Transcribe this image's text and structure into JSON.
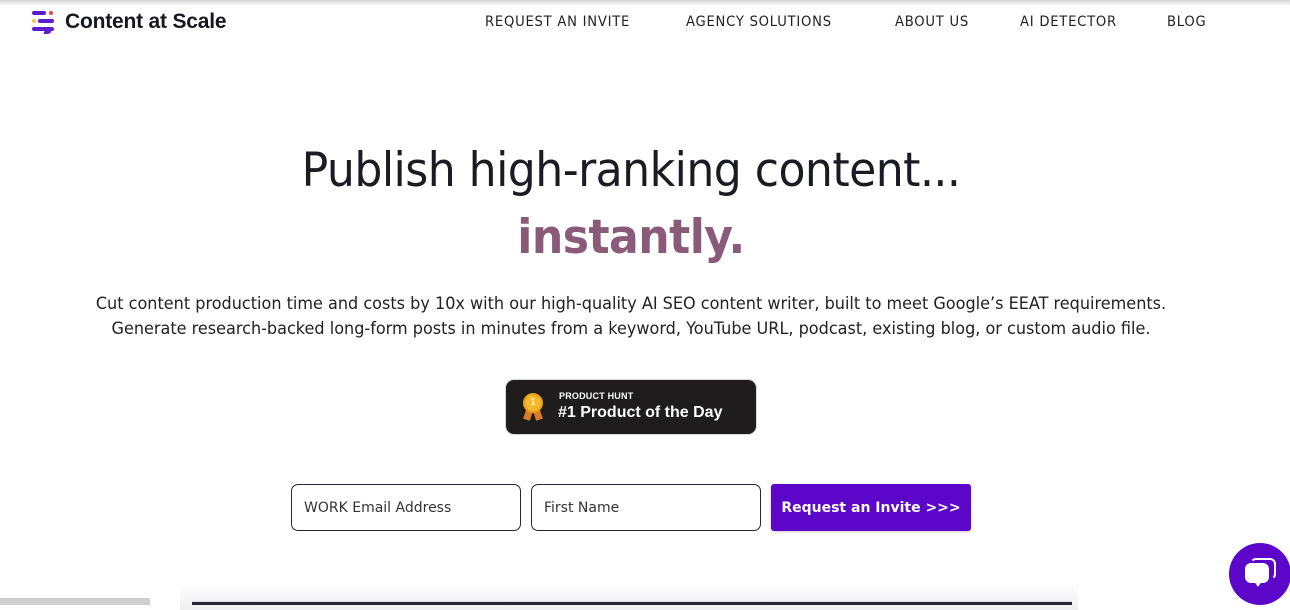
{
  "header": {
    "logo_text": "Content at Scale",
    "logo_icon": "stacked-lines-logo-icon",
    "nav": [
      {
        "label": "REQUEST AN INVITE"
      },
      {
        "label": "AGENCY SOLUTIONS"
      },
      {
        "label": "ABOUT US"
      },
      {
        "label": "AI DETECTOR"
      },
      {
        "label": "BLOG"
      }
    ]
  },
  "hero": {
    "title": "Publish high-ranking content...",
    "accent": "instantly.",
    "subtitle_line1": "Cut content production time and costs by 10x with our high-quality AI SEO content writer, built to meet Google’s EEAT requirements.",
    "subtitle_line2": "Generate research-backed long-form posts in minutes from a keyword, YouTube URL, podcast, existing blog, or custom audio file."
  },
  "badge": {
    "kicker": "PRODUCT HUNT",
    "title": "#1 Product of the Day",
    "medal_number": "1",
    "icon": "medal-icon"
  },
  "form": {
    "email_placeholder": "WORK Email Address",
    "email_value": "",
    "name_placeholder": "First Name",
    "name_value": "",
    "submit_label": "Request an Invite >>>"
  },
  "chat": {
    "icon": "chat-bubble-icon"
  },
  "colors": {
    "brand": "#5b06c9",
    "accent_text": "#8a5a79",
    "badge_bg": "#1f1c1e"
  }
}
